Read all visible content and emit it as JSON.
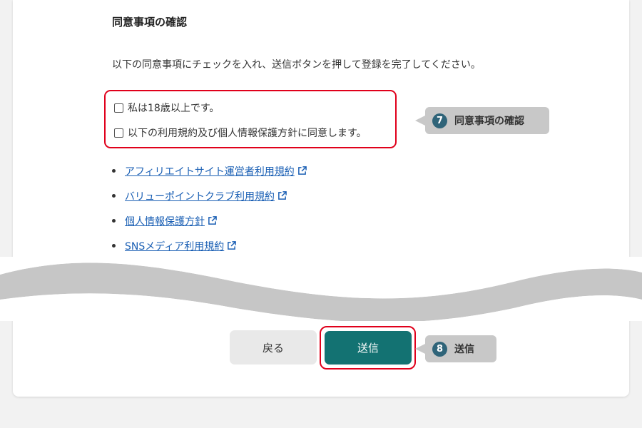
{
  "section": {
    "title": "同意事項の確認",
    "instruction": "以下の同意事項にチェックを入れ、送信ボタンを押して登録を完了してください。"
  },
  "consents": [
    {
      "label": "私は18歳以上です。",
      "checked": false
    },
    {
      "label": "以下の利用規約及び個人情報保護方針に同意します。",
      "checked": false
    }
  ],
  "links": [
    {
      "label": "アフィリエイトサイト運営者利用規約",
      "icon": "external-link-icon"
    },
    {
      "label": "バリューポイントクラブ利用規約",
      "icon": "external-link-icon"
    },
    {
      "label": "個人情報保護方針",
      "icon": "external-link-icon"
    },
    {
      "label": "SNSメディア利用規約",
      "icon": "external-link-icon"
    }
  ],
  "callouts": {
    "consent": {
      "number": "7",
      "label": "同意事項の確認"
    },
    "submit": {
      "number": "8",
      "label": "送信"
    }
  },
  "buttons": {
    "back_label": "戻る",
    "submit_label": "送信"
  },
  "colors": {
    "highlight": "#e0001b",
    "submit_bg": "#137272",
    "link": "#1a5fb4",
    "callout_badge": "#2f6479",
    "callout_bg": "#c8c8c8"
  }
}
